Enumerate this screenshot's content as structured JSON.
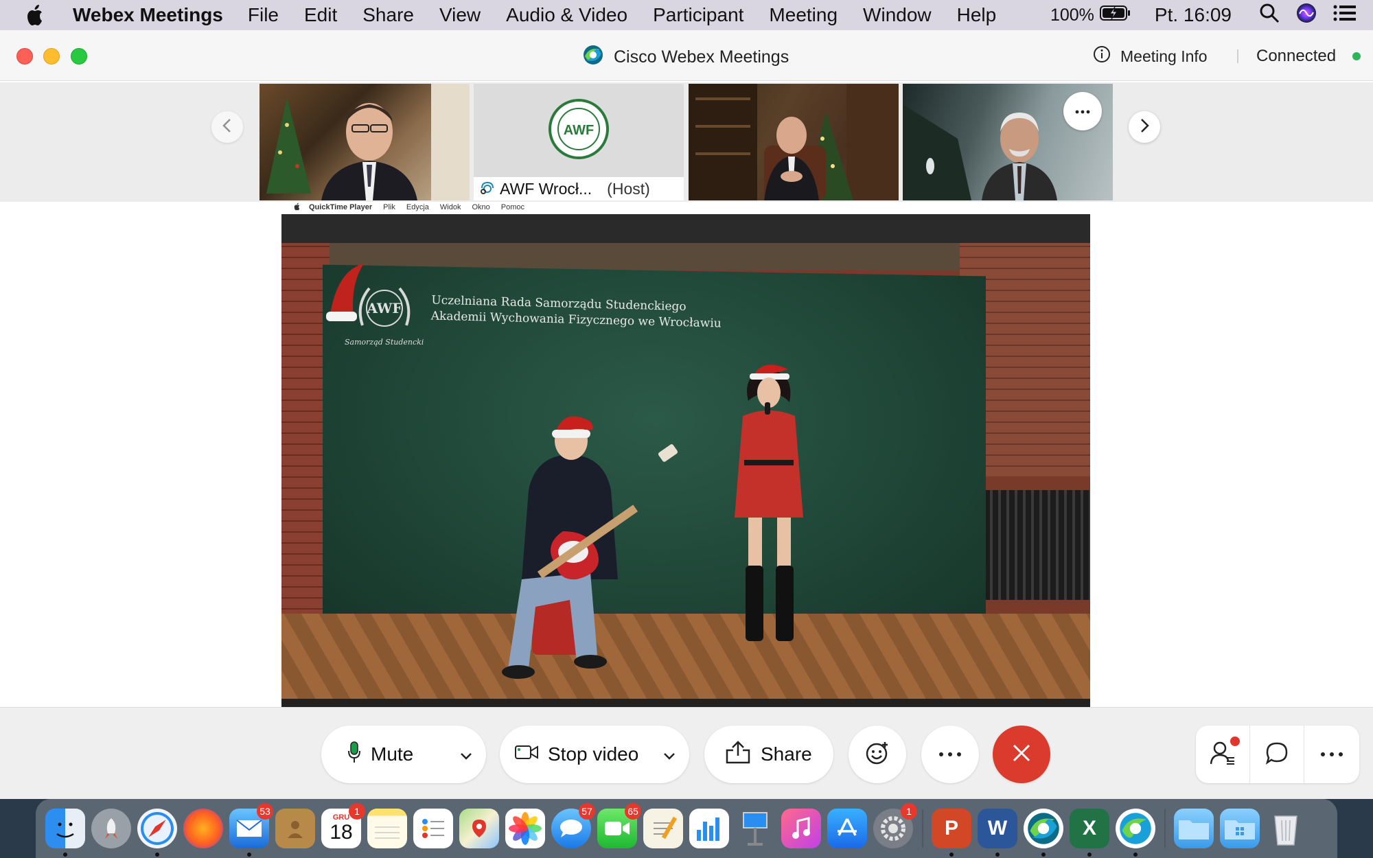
{
  "menubar": {
    "app_name": "Webex Meetings",
    "items": [
      "File",
      "Edit",
      "Share",
      "View",
      "Audio & Video",
      "Participant",
      "Meeting",
      "Window",
      "Help"
    ],
    "battery": "100%",
    "clock": "Pt. 16:09"
  },
  "window": {
    "title": "Cisco Webex Meetings",
    "meeting_info": "Meeting Info",
    "status": "Connected",
    "status_color": "#2fb35b"
  },
  "filmstrip": {
    "tiles": [
      {
        "name": ""
      },
      {
        "name": "AWF Wrocł...",
        "role": "(Host)"
      },
      {
        "name": ""
      },
      {
        "name": ""
      }
    ]
  },
  "shared": {
    "qt_menu": {
      "app": "QuickTime Player",
      "items": [
        "Plik",
        "Edycja",
        "Widok",
        "Okno",
        "Pomoc"
      ]
    },
    "banner_line1": "Uczelniana Rada Samorządu Studenckiego",
    "banner_line2": "Akademii Wychowania Fizycznego we Wrocławiu",
    "logo_text": "AWF",
    "logo_caption": "Samorząd Studencki"
  },
  "controls": {
    "mute": "Mute",
    "stop_video": "Stop video",
    "share": "Share",
    "leave_color": "#db3b2c"
  },
  "dock": {
    "calendar_day": "18",
    "calendar_month": "GRU",
    "badges": {
      "mail": "53",
      "calendar": "1",
      "messages": "57",
      "facetime": "65",
      "settings": "1"
    }
  }
}
